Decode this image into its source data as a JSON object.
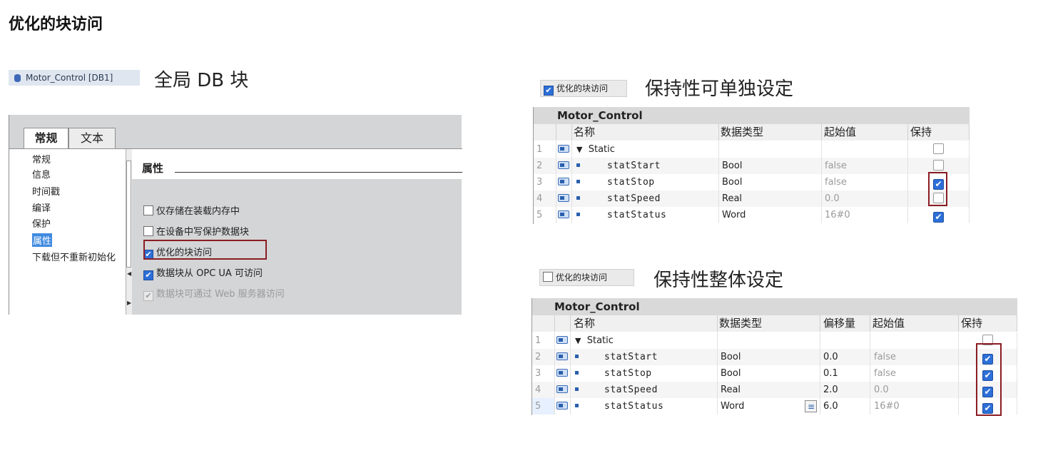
{
  "title": "优化的块访问",
  "db": {
    "chip_label": "Motor_Control [DB1]",
    "caption": "全局 DB 块"
  },
  "dialog": {
    "tabs": [
      "常规",
      "文本"
    ],
    "nav": [
      "常规",
      "信息",
      "时间戳",
      "编译",
      "保护",
      "属性",
      "下载但不重新初始化"
    ],
    "selected_nav": "属性",
    "section_title": "属性",
    "options": [
      {
        "label": "仅存储在装载内存中",
        "checked": false,
        "disabled": false
      },
      {
        "label": "在设备中写保护数据块",
        "checked": false,
        "disabled": false
      },
      {
        "label": "优化的块访问",
        "checked": true,
        "disabled": false
      },
      {
        "label": "数据块从 OPC UA 可访问",
        "checked": true,
        "disabled": false
      },
      {
        "label": "数据块可通过 Web 服务器访问",
        "checked": true,
        "disabled": true
      }
    ]
  },
  "panel1": {
    "toggle_label": "优化的块访问",
    "toggle_checked": true,
    "caption": "保持性可单独设定",
    "table_title": "Motor_Control",
    "headers": [
      "名称",
      "数据类型",
      "起始值",
      "保持"
    ],
    "rows": [
      {
        "no": "1",
        "name": "Static",
        "type": "",
        "start": "",
        "retain": false
      },
      {
        "no": "2",
        "name": "statStart",
        "type": "Bool",
        "start": "false",
        "retain": false
      },
      {
        "no": "3",
        "name": "statStop",
        "type": "Bool",
        "start": "false",
        "retain": true
      },
      {
        "no": "4",
        "name": "statSpeed",
        "type": "Real",
        "start": "0.0",
        "retain": false
      },
      {
        "no": "5",
        "name": "statStatus",
        "type": "Word",
        "start": "16#0",
        "retain": true
      }
    ]
  },
  "panel2": {
    "toggle_label": "优化的块访问",
    "toggle_checked": false,
    "caption": "保持性整体设定",
    "table_title": "Motor_Control",
    "headers": [
      "名称",
      "数据类型",
      "偏移量",
      "起始值",
      "保持"
    ],
    "rows": [
      {
        "no": "1",
        "name": "Static",
        "type": "",
        "offset": "",
        "start": "",
        "retain": false
      },
      {
        "no": "2",
        "name": "statStart",
        "type": "Bool",
        "offset": "0.0",
        "start": "false",
        "retain": true
      },
      {
        "no": "3",
        "name": "statStop",
        "type": "Bool",
        "offset": "0.1",
        "start": "false",
        "retain": true
      },
      {
        "no": "4",
        "name": "statSpeed",
        "type": "Real",
        "offset": "2.0",
        "start": "0.0",
        "retain": true
      },
      {
        "no": "5",
        "name": "statStatus",
        "type": "Word",
        "offset": "6.0",
        "start": "16#0",
        "retain": true
      }
    ]
  },
  "colors": {
    "highlight_box": "#8b1d24",
    "checkbox_on": "#2d6fd8",
    "nav_selected": "#3f8ae0"
  }
}
